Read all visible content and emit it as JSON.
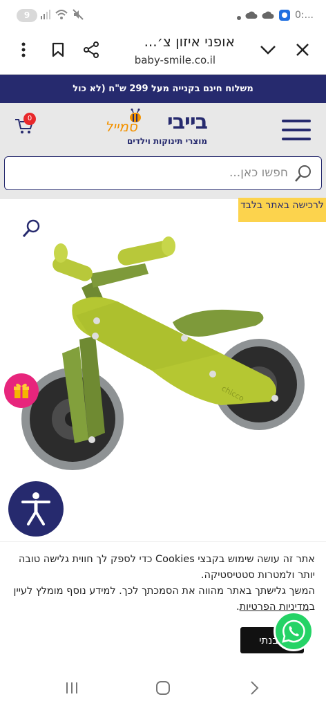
{
  "status_bar": {
    "notification_count": "9",
    "time": "0:..."
  },
  "browser": {
    "page_title": "אופני איזון צ׳...",
    "url": "baby-smile.co.il",
    "icons": [
      "menu-dots-icon",
      "bookmark-icon",
      "share-icon",
      "chevron-down-icon",
      "close-icon"
    ]
  },
  "promo": {
    "text": "משלוח חינם בקנייה מעל 299 ש\"ח (לא כול"
  },
  "header": {
    "logo_main": "בייבי",
    "logo_accent": "סמייל",
    "logo_tagline": "מוצרי תינוקות וילדים",
    "cart_count": "0",
    "brand_color": "#262a6e",
    "accent_color": "#f39200"
  },
  "search": {
    "placeholder": "חפשו כאן..."
  },
  "product": {
    "ribbon_text": "לרכישה באתר בלבד",
    "ribbon_color": "#fcd34d",
    "image": "lime-green balance bike",
    "image_brand_mark": "chicco"
  },
  "floating": {
    "gift_icon": "gift-icon",
    "accessibility_icon": "accessibility-icon",
    "whatsapp_icon": "whatsapp-icon"
  },
  "cookie": {
    "line1": "אתר זה עושה שימוש בקבצי Cookies כדי לספק לך חווית גלישה טובה יותר ולמטרות סטטיסטיקה.",
    "line2_prefix": "המשך גלישתך באתר מהווה את הסמכתך לכך. למידע נוסף מומלץ לעיין ב",
    "link": "מדיניות הפרטיות",
    "line2_suffix": ".",
    "accept_label": "הבנתי"
  },
  "navbar": {
    "icons": [
      "recents-icon",
      "home-icon",
      "back-icon"
    ]
  }
}
